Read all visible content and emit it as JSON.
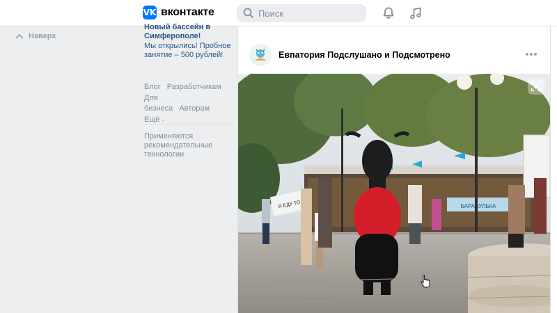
{
  "header": {
    "logo_mark": "VK",
    "logo_text": "вконтакте",
    "search_placeholder": "Поиск"
  },
  "left": {
    "up_label": "Наверх",
    "promo_title": "Новый бассейн в Симферополе!",
    "promo_text": "Мы открылись! Пробное занятие – 500 рублей!",
    "links": [
      "Блог",
      "Разработчикам",
      "Для бизнеса",
      "Авторам",
      "Ещё"
    ],
    "recommendation_note": "Применяются рекомендательные технологии"
  },
  "post": {
    "group_name": "Евпатория Подслушано и Подсмотрено",
    "sign_text": "Я ЕДУ ТО",
    "banner_text": "БАРАБУЛЬКА"
  },
  "colors": {
    "accent": "#0077ff",
    "link": "#2a5885",
    "muted": "#818c99",
    "background": "#edeef0"
  },
  "icons": [
    "vk-logo-icon",
    "search-icon",
    "bell-icon",
    "music-icon",
    "chevron-up-icon",
    "more-icon",
    "lens-icon",
    "cursor-icon"
  ]
}
